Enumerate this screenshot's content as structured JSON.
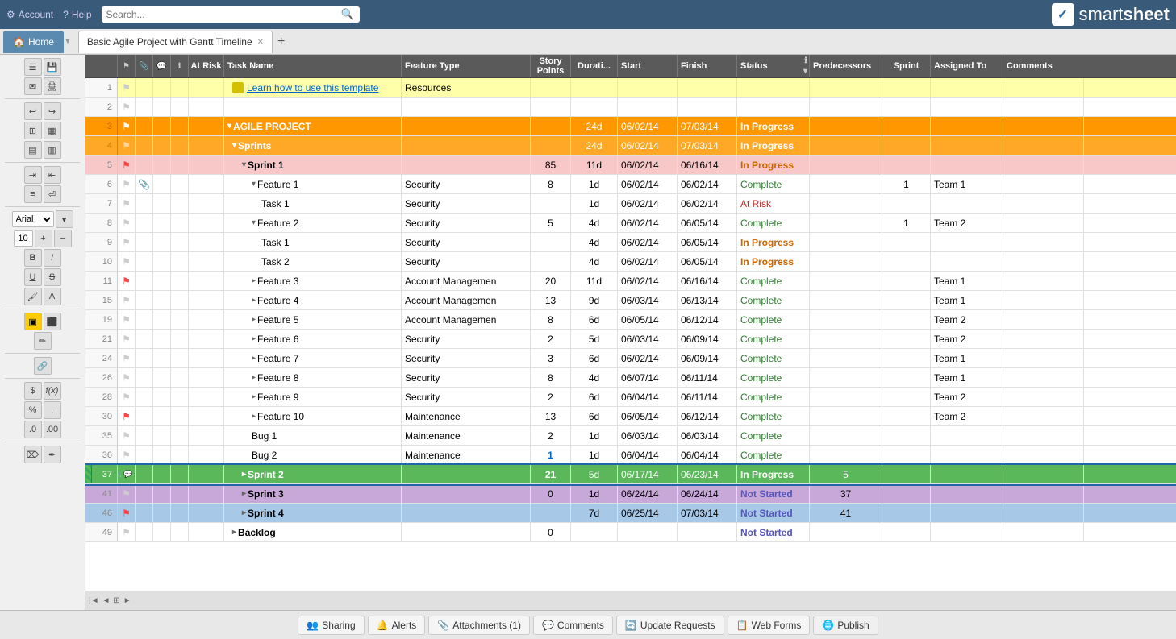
{
  "app": {
    "title": "smartsheet",
    "logo_check": "✓"
  },
  "topbar": {
    "account": "Account",
    "help": "Help",
    "search_placeholder": "Search..."
  },
  "tabs": {
    "home": "Home",
    "sheet": "Basic Agile Project with Gantt Timeline",
    "add_tab": "+"
  },
  "columns": [
    {
      "id": "at_risk",
      "label": "At Risk",
      "sub": ""
    },
    {
      "id": "task_name",
      "label": "Task Name",
      "sub": ""
    },
    {
      "id": "feature_type",
      "label": "Feature Type",
      "sub": ""
    },
    {
      "id": "story_points",
      "label": "Story Points",
      "sub": ""
    },
    {
      "id": "duration",
      "label": "Durati...",
      "sub": ""
    },
    {
      "id": "start",
      "label": "Start",
      "sub": ""
    },
    {
      "id": "finish",
      "label": "Finish",
      "sub": ""
    },
    {
      "id": "status",
      "label": "Status",
      "sub": ""
    },
    {
      "id": "predecessors",
      "label": "Predecessors",
      "sub": ""
    },
    {
      "id": "sprint",
      "label": "Sprint",
      "sub": ""
    },
    {
      "id": "assigned_to",
      "label": "Assigned To",
      "sub": ""
    },
    {
      "id": "comments",
      "label": "Comments",
      "sub": ""
    }
  ],
  "rows": [
    {
      "num": "1",
      "flag": false,
      "flagRed": false,
      "indent": 1,
      "task": "Learn how to use this template",
      "task_link": true,
      "feature_type": "Resources",
      "story_pts": "",
      "duration": "",
      "start": "",
      "finish": "",
      "status": "",
      "predecessors": "",
      "sprint": "",
      "assigned_to": "",
      "comments": "",
      "row_style": "yellow"
    },
    {
      "num": "2",
      "flag": false,
      "flagRed": false,
      "indent": 0,
      "task": "",
      "feature_type": "",
      "story_pts": "",
      "duration": "",
      "start": "",
      "finish": "",
      "status": "",
      "predecessors": "",
      "sprint": "",
      "assigned_to": "",
      "comments": "",
      "row_style": ""
    },
    {
      "num": "3",
      "flag": true,
      "flagRed": true,
      "indent": 0,
      "task": "AGILE PROJECT",
      "expand": "-",
      "feature_type": "",
      "story_pts": "",
      "duration": "24d",
      "start": "06/02/14",
      "finish": "07/03/14",
      "status": "In Progress",
      "predecessors": "",
      "sprint": "",
      "assigned_to": "",
      "comments": "",
      "row_style": "orange"
    },
    {
      "num": "4",
      "flag": true,
      "flagRed": false,
      "indent": 1,
      "task": "Sprints",
      "expand": "-",
      "feature_type": "",
      "story_pts": "",
      "duration": "24d",
      "start": "06/02/14",
      "finish": "07/03/14",
      "status": "In Progress",
      "predecessors": "",
      "sprint": "",
      "assigned_to": "",
      "comments": "",
      "row_style": "orange2"
    },
    {
      "num": "5",
      "flag": true,
      "flagRed": true,
      "indent": 2,
      "task": "Sprint 1",
      "expand": "-",
      "feature_type": "",
      "story_pts": "85",
      "duration": "11d",
      "start": "06/02/14",
      "finish": "06/16/14",
      "status": "In Progress",
      "predecessors": "",
      "sprint": "",
      "assigned_to": "",
      "comments": "",
      "row_style": "pink"
    },
    {
      "num": "6",
      "flag": false,
      "flagRed": false,
      "indent": 3,
      "task": "Feature 1",
      "expand": "-",
      "feature_type": "Security",
      "story_pts": "8",
      "duration": "1d",
      "start": "06/02/14",
      "finish": "06/02/14",
      "status": "Complete",
      "predecessors": "",
      "sprint": "1",
      "assigned_to": "Team 1",
      "comments": "",
      "row_style": ""
    },
    {
      "num": "7",
      "flag": false,
      "flagRed": false,
      "indent": 4,
      "task": "Task 1",
      "feature_type": "Security",
      "story_pts": "",
      "duration": "1d",
      "start": "06/02/14",
      "finish": "06/02/14",
      "status": "At Risk",
      "predecessors": "",
      "sprint": "",
      "assigned_to": "",
      "comments": "",
      "row_style": ""
    },
    {
      "num": "8",
      "flag": false,
      "flagRed": false,
      "indent": 3,
      "task": "Feature 2",
      "expand": "-",
      "feature_type": "Security",
      "story_pts": "5",
      "duration": "4d",
      "start": "06/02/14",
      "finish": "06/05/14",
      "status": "Complete",
      "predecessors": "",
      "sprint": "1",
      "assigned_to": "Team 2",
      "comments": "",
      "row_style": ""
    },
    {
      "num": "9",
      "flag": false,
      "flagRed": false,
      "indent": 4,
      "task": "Task 1",
      "feature_type": "Security",
      "story_pts": "",
      "duration": "4d",
      "start": "06/02/14",
      "finish": "06/05/14",
      "status": "In Progress",
      "predecessors": "",
      "sprint": "",
      "assigned_to": "",
      "comments": "",
      "row_style": ""
    },
    {
      "num": "10",
      "flag": false,
      "flagRed": false,
      "indent": 4,
      "task": "Task 2",
      "feature_type": "Security",
      "story_pts": "",
      "duration": "4d",
      "start": "06/02/14",
      "finish": "06/05/14",
      "status": "In Progress",
      "predecessors": "",
      "sprint": "",
      "assigned_to": "",
      "comments": "",
      "row_style": ""
    },
    {
      "num": "11",
      "flag": true,
      "flagRed": true,
      "indent": 3,
      "task": "Feature 3",
      "expand": "+",
      "feature_type": "Account Managemen",
      "story_pts": "20",
      "duration": "11d",
      "start": "06/02/14",
      "finish": "06/16/14",
      "status": "Complete",
      "predecessors": "",
      "sprint": "",
      "assigned_to": "Team 1",
      "comments": "",
      "row_style": ""
    },
    {
      "num": "15",
      "flag": false,
      "flagRed": false,
      "indent": 3,
      "task": "Feature 4",
      "expand": "+",
      "feature_type": "Account Managemen",
      "story_pts": "13",
      "duration": "9d",
      "start": "06/03/14",
      "finish": "06/13/14",
      "status": "Complete",
      "predecessors": "",
      "sprint": "",
      "assigned_to": "Team 1",
      "comments": "",
      "row_style": ""
    },
    {
      "num": "19",
      "flag": false,
      "flagRed": false,
      "indent": 3,
      "task": "Feature 5",
      "expand": "+",
      "feature_type": "Account Managemen",
      "story_pts": "8",
      "duration": "6d",
      "start": "06/05/14",
      "finish": "06/12/14",
      "status": "Complete",
      "predecessors": "",
      "sprint": "",
      "assigned_to": "Team 2",
      "comments": "",
      "row_style": ""
    },
    {
      "num": "21",
      "flag": false,
      "flagRed": false,
      "indent": 3,
      "task": "Feature 6",
      "expand": "+",
      "feature_type": "Security",
      "story_pts": "2",
      "duration": "5d",
      "start": "06/03/14",
      "finish": "06/09/14",
      "status": "Complete",
      "predecessors": "",
      "sprint": "",
      "assigned_to": "Team 2",
      "comments": "",
      "row_style": ""
    },
    {
      "num": "24",
      "flag": false,
      "flagRed": false,
      "indent": 3,
      "task": "Feature 7",
      "expand": "+",
      "feature_type": "Security",
      "story_pts": "3",
      "duration": "6d",
      "start": "06/02/14",
      "finish": "06/09/14",
      "status": "Complete",
      "predecessors": "",
      "sprint": "",
      "assigned_to": "Team 1",
      "comments": "",
      "row_style": ""
    },
    {
      "num": "26",
      "flag": false,
      "flagRed": false,
      "indent": 3,
      "task": "Feature 8",
      "expand": "+",
      "feature_type": "Security",
      "story_pts": "8",
      "duration": "4d",
      "start": "06/07/14",
      "finish": "06/11/14",
      "status": "Complete",
      "predecessors": "",
      "sprint": "",
      "assigned_to": "Team 1",
      "comments": "",
      "row_style": ""
    },
    {
      "num": "28",
      "flag": false,
      "flagRed": false,
      "indent": 3,
      "task": "Feature 9",
      "expand": "+",
      "feature_type": "Security",
      "story_pts": "2",
      "duration": "6d",
      "start": "06/04/14",
      "finish": "06/11/14",
      "status": "Complete",
      "predecessors": "",
      "sprint": "",
      "assigned_to": "Team 2",
      "comments": "",
      "row_style": ""
    },
    {
      "num": "30",
      "flag": true,
      "flagRed": true,
      "indent": 3,
      "task": "Feature 10",
      "expand": "+",
      "feature_type": "Maintenance",
      "story_pts": "13",
      "duration": "6d",
      "start": "06/05/14",
      "finish": "06/12/14",
      "status": "Complete",
      "predecessors": "",
      "sprint": "",
      "assigned_to": "Team 2",
      "comments": "",
      "row_style": ""
    },
    {
      "num": "35",
      "flag": false,
      "flagRed": false,
      "indent": 3,
      "task": "Bug 1",
      "feature_type": "Maintenance",
      "story_pts": "2",
      "duration": "1d",
      "start": "06/03/14",
      "finish": "06/03/14",
      "status": "Complete",
      "predecessors": "",
      "sprint": "",
      "assigned_to": "",
      "comments": "",
      "row_style": ""
    },
    {
      "num": "36",
      "flag": false,
      "flagRed": false,
      "indent": 3,
      "task": "Bug 2",
      "feature_type": "Maintenance",
      "story_pts": "1",
      "duration": "1d",
      "start": "06/04/14",
      "finish": "06/04/14",
      "status": "Complete",
      "predecessors": "",
      "sprint": "",
      "assigned_to": "",
      "comments": "",
      "row_style": ""
    },
    {
      "num": "37",
      "flag": true,
      "flagRed": false,
      "indent": 2,
      "task": "Sprint 2",
      "expand": "+",
      "feature_type": "",
      "story_pts": "21",
      "duration": "5d",
      "start": "06/17/14",
      "finish": "06/23/14",
      "status": "In Progress",
      "predecessors": "5",
      "sprint": "",
      "assigned_to": "",
      "comments": "",
      "row_style": "green",
      "selected": true
    },
    {
      "num": "41",
      "flag": false,
      "flagRed": false,
      "indent": 2,
      "task": "Sprint 3",
      "expand": "+",
      "feature_type": "",
      "story_pts": "0",
      "duration": "1d",
      "start": "06/24/14",
      "finish": "06/24/14",
      "status": "Not Started",
      "predecessors": "37",
      "sprint": "",
      "assigned_to": "",
      "comments": "",
      "row_style": "purple"
    },
    {
      "num": "46",
      "flag": true,
      "flagRed": true,
      "indent": 2,
      "task": "Sprint 4",
      "expand": "+",
      "feature_type": "",
      "story_pts": "",
      "duration": "7d",
      "start": "06/25/14",
      "finish": "07/03/14",
      "status": "Not Started",
      "predecessors": "41",
      "sprint": "",
      "assigned_to": "",
      "comments": "",
      "row_style": "blue"
    },
    {
      "num": "49",
      "flag": false,
      "flagRed": false,
      "indent": 1,
      "task": "Backlog",
      "expand": "+",
      "feature_type": "",
      "story_pts": "0",
      "duration": "",
      "start": "",
      "finish": "",
      "status": "Not Started",
      "predecessors": "",
      "sprint": "",
      "assigned_to": "",
      "comments": "",
      "row_style": ""
    }
  ],
  "bottom_bar": {
    "sharing": "Sharing",
    "alerts": "Alerts",
    "attachments": "Attachments (1)",
    "comments": "Comments",
    "update_requests": "Update Requests",
    "web_forms": "Web Forms",
    "publish": "Publish"
  }
}
